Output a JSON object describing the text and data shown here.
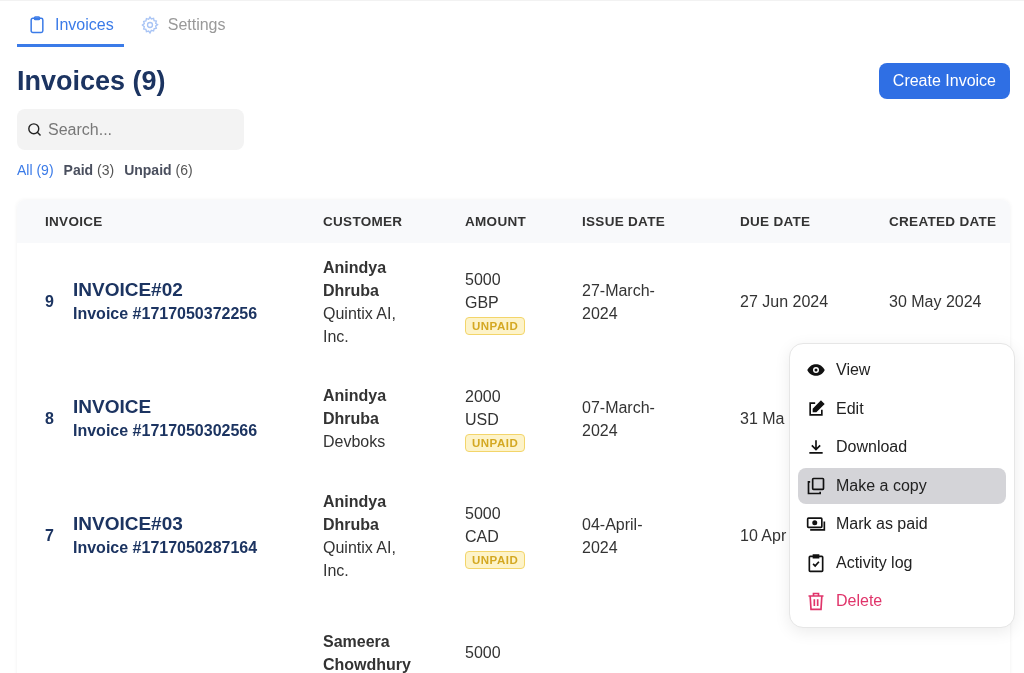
{
  "tabs": [
    {
      "label": "Invoices",
      "selected": true
    },
    {
      "label": "Settings",
      "selected": false
    }
  ],
  "title": "Invoices (9)",
  "create_button": "Create Invoice",
  "search": {
    "placeholder": "Search..."
  },
  "filters": [
    {
      "label": "All",
      "count": "(9)",
      "selected": true
    },
    {
      "label": "Paid",
      "count": "(3)",
      "selected": false
    },
    {
      "label": "Unpaid",
      "count": "(6)",
      "selected": false
    }
  ],
  "table": {
    "columns": [
      "INVOICE",
      "CUSTOMER",
      "AMOUNT",
      "ISSUE DATE",
      "DUE DATE",
      "CREATED DATE"
    ],
    "rows": [
      {
        "number": "9",
        "title": "INVOICE#02",
        "invoice_no": "Invoice #1717050372256",
        "customer": "Anindya Dhruba",
        "company": "Quintix AI, Inc.",
        "amount": "5000 GBP",
        "status": "UNPAID",
        "issue_date": "27-March-2024",
        "due_date": "27 Jun 2024",
        "created_date": "30 May 2024"
      },
      {
        "number": "8",
        "title": "INVOICE",
        "invoice_no": "Invoice #1717050302566",
        "customer": "Anindya Dhruba",
        "company": "Devboks",
        "amount": "2000 USD",
        "status": "UNPAID",
        "issue_date": "07-March-2024",
        "due_date": "31 Ma"
      },
      {
        "number": "7",
        "title": "INVOICE#03",
        "invoice_no": "Invoice #1717050287164",
        "customer": "Anindya Dhruba",
        "company": "Quintix AI, Inc.",
        "amount": "5000 CAD",
        "status": "UNPAID",
        "issue_date": "04-April-2024",
        "due_date": "10 Apr"
      },
      {
        "customer": "Sameera Chowdhury",
        "amount": "5000"
      }
    ]
  },
  "menu": [
    {
      "label": "View",
      "kind": "normal",
      "selected": false
    },
    {
      "label": "Edit",
      "kind": "normal",
      "selected": false
    },
    {
      "label": "Download",
      "kind": "normal",
      "selected": false
    },
    {
      "label": "Make a copy",
      "kind": "normal",
      "selected": true
    },
    {
      "label": "Mark as paid",
      "kind": "normal",
      "selected": false
    },
    {
      "label": "Activity log",
      "kind": "normal",
      "selected": false
    },
    {
      "label": "Delete",
      "kind": "danger",
      "selected": false
    }
  ]
}
